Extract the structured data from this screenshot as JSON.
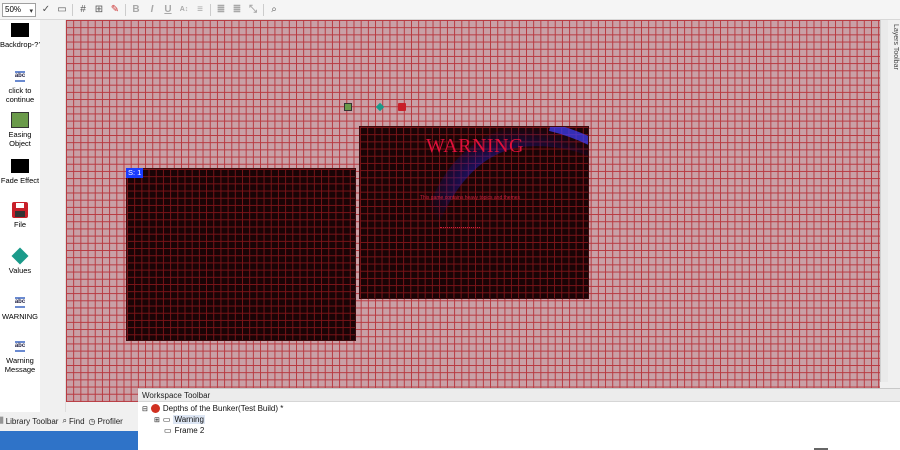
{
  "toolbar": {
    "zoom_value": "50%",
    "icons": [
      "pointer-icon",
      "scene-icon",
      "grid-icon",
      "snap-icon",
      "pen-icon",
      "bold-icon",
      "italic-icon",
      "underline-icon",
      "font-size-icon",
      "align-icon",
      "indent-icon",
      "outdent-icon",
      "resize-icon",
      "search-icon"
    ],
    "bold_glyph": "B",
    "italic_glyph": "I",
    "underline_glyph": "U"
  },
  "library": {
    "items": [
      {
        "label": "Backdrop-??",
        "icon": "black-rect-icon"
      },
      {
        "label": "click to continue",
        "icon": "abc-text-icon"
      },
      {
        "label": "Easing Object",
        "icon": "easing-image-icon"
      },
      {
        "label": "Fade Effect",
        "icon": "black-rect-icon"
      },
      {
        "label": "File",
        "icon": "floppy-disk-icon"
      },
      {
        "label": "Values",
        "icon": "diamond-icon"
      },
      {
        "label": "WARNING",
        "icon": "abc-text-icon"
      },
      {
        "label": "Warning Message",
        "icon": "abc-text-icon"
      }
    ]
  },
  "stage": {
    "scene_badge": "S: 1",
    "warning_title": "WARNING",
    "warning_body": "This game contains heavy topics and themes"
  },
  "right_panel": {
    "label": "Layers Toolbar"
  },
  "bottom_tabs": [
    {
      "label": "Library Toolbar",
      "icon": "library-icon"
    },
    {
      "label": "Find",
      "icon": "search-icon"
    },
    {
      "label": "Profiler",
      "icon": "clock-icon"
    }
  ],
  "workspace": {
    "title": "Workspace Toolbar",
    "project": "Depths of the Bunker(Test Build) *",
    "frames": [
      "Warning",
      "Frame 2"
    ]
  },
  "colors": {
    "stage_grid": "#b8383f",
    "stage_bg": "#c9a0a6",
    "frame_bg": "#1a0406",
    "warning_red": "#e0103a",
    "status_blue": "#2f73c8"
  }
}
